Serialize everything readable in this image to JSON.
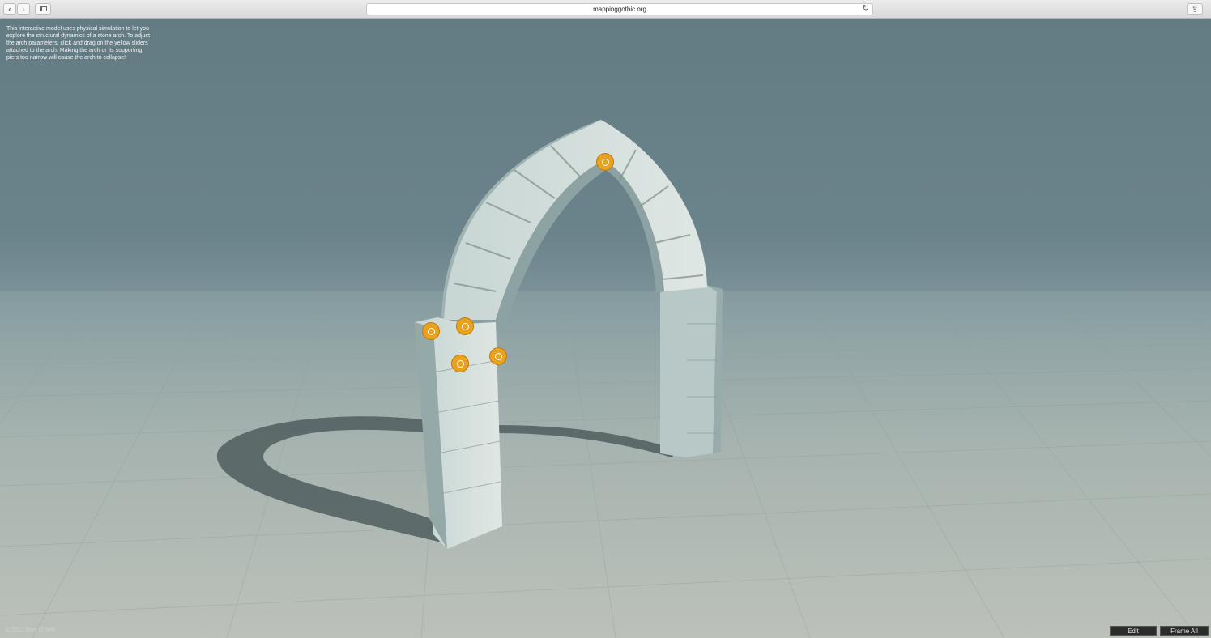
{
  "browser": {
    "url": "mappinggothic.org",
    "back_icon": "chevron-left-icon",
    "forward_icon": "chevron-right-icon",
    "sidebar_icon": "sidebar-icon",
    "reload_icon": "reload-icon",
    "share_icon": "share-icon"
  },
  "viewer": {
    "info_text": "This interactive model uses  physical simulation to let you explore the structural dynamics of a stone arch. To adjust the arch parameters, click and drag on the yellow sliders attached to the arch. Making the arch or its supporting piers too narrow will cause the arch to collapse!",
    "copyright": "© 2011 Rory O'Neill",
    "edit_label": "Edit",
    "frame_all_label": "Frame All",
    "handle_color": "#e8a21d",
    "handles": [
      "apex-handle",
      "pier-width-handle",
      "arch-thickness-handle",
      "pier-depth-handle",
      "springing-handle"
    ]
  }
}
